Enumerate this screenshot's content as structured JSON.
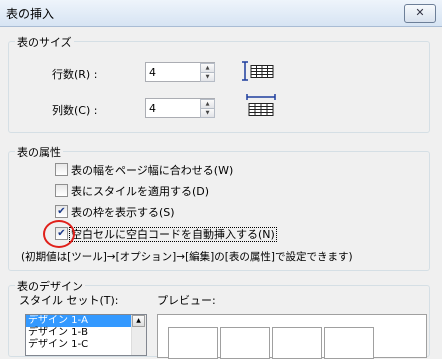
{
  "window": {
    "title": "表の挿入",
    "close_glyph": "✕"
  },
  "size_group": {
    "label": "表のサイズ",
    "rows_label": "行数(R) :",
    "rows_value": "4",
    "cols_label": "列数(C) :",
    "cols_value": "4"
  },
  "attrs_group": {
    "label": "表の属性",
    "checkboxes": [
      {
        "label": "表の幅をページ幅に合わせる(W)",
        "checked": false
      },
      {
        "label": "表にスタイルを適用する(D)",
        "checked": false
      },
      {
        "label": "表の枠を表示する(S)",
        "checked": true
      },
      {
        "label": "空白セルに空白コードを自動挿入する(N)",
        "checked": true
      }
    ],
    "note": "(初期値は[ツール]→[オプション]→[編集]の[表の属性]で設定できます)"
  },
  "design_group": {
    "label": "表のデザイン",
    "style_set_label": "スタイル セット(T):",
    "preview_label": "プレビュー:",
    "style_items": [
      "デザイン 1-A",
      "デザイン 1-B",
      "デザイン 1-C"
    ],
    "selected_index": 0
  },
  "colors": {
    "highlight": "#e0201a",
    "icon": "#1d3e9e",
    "selection": "#3399ff"
  }
}
